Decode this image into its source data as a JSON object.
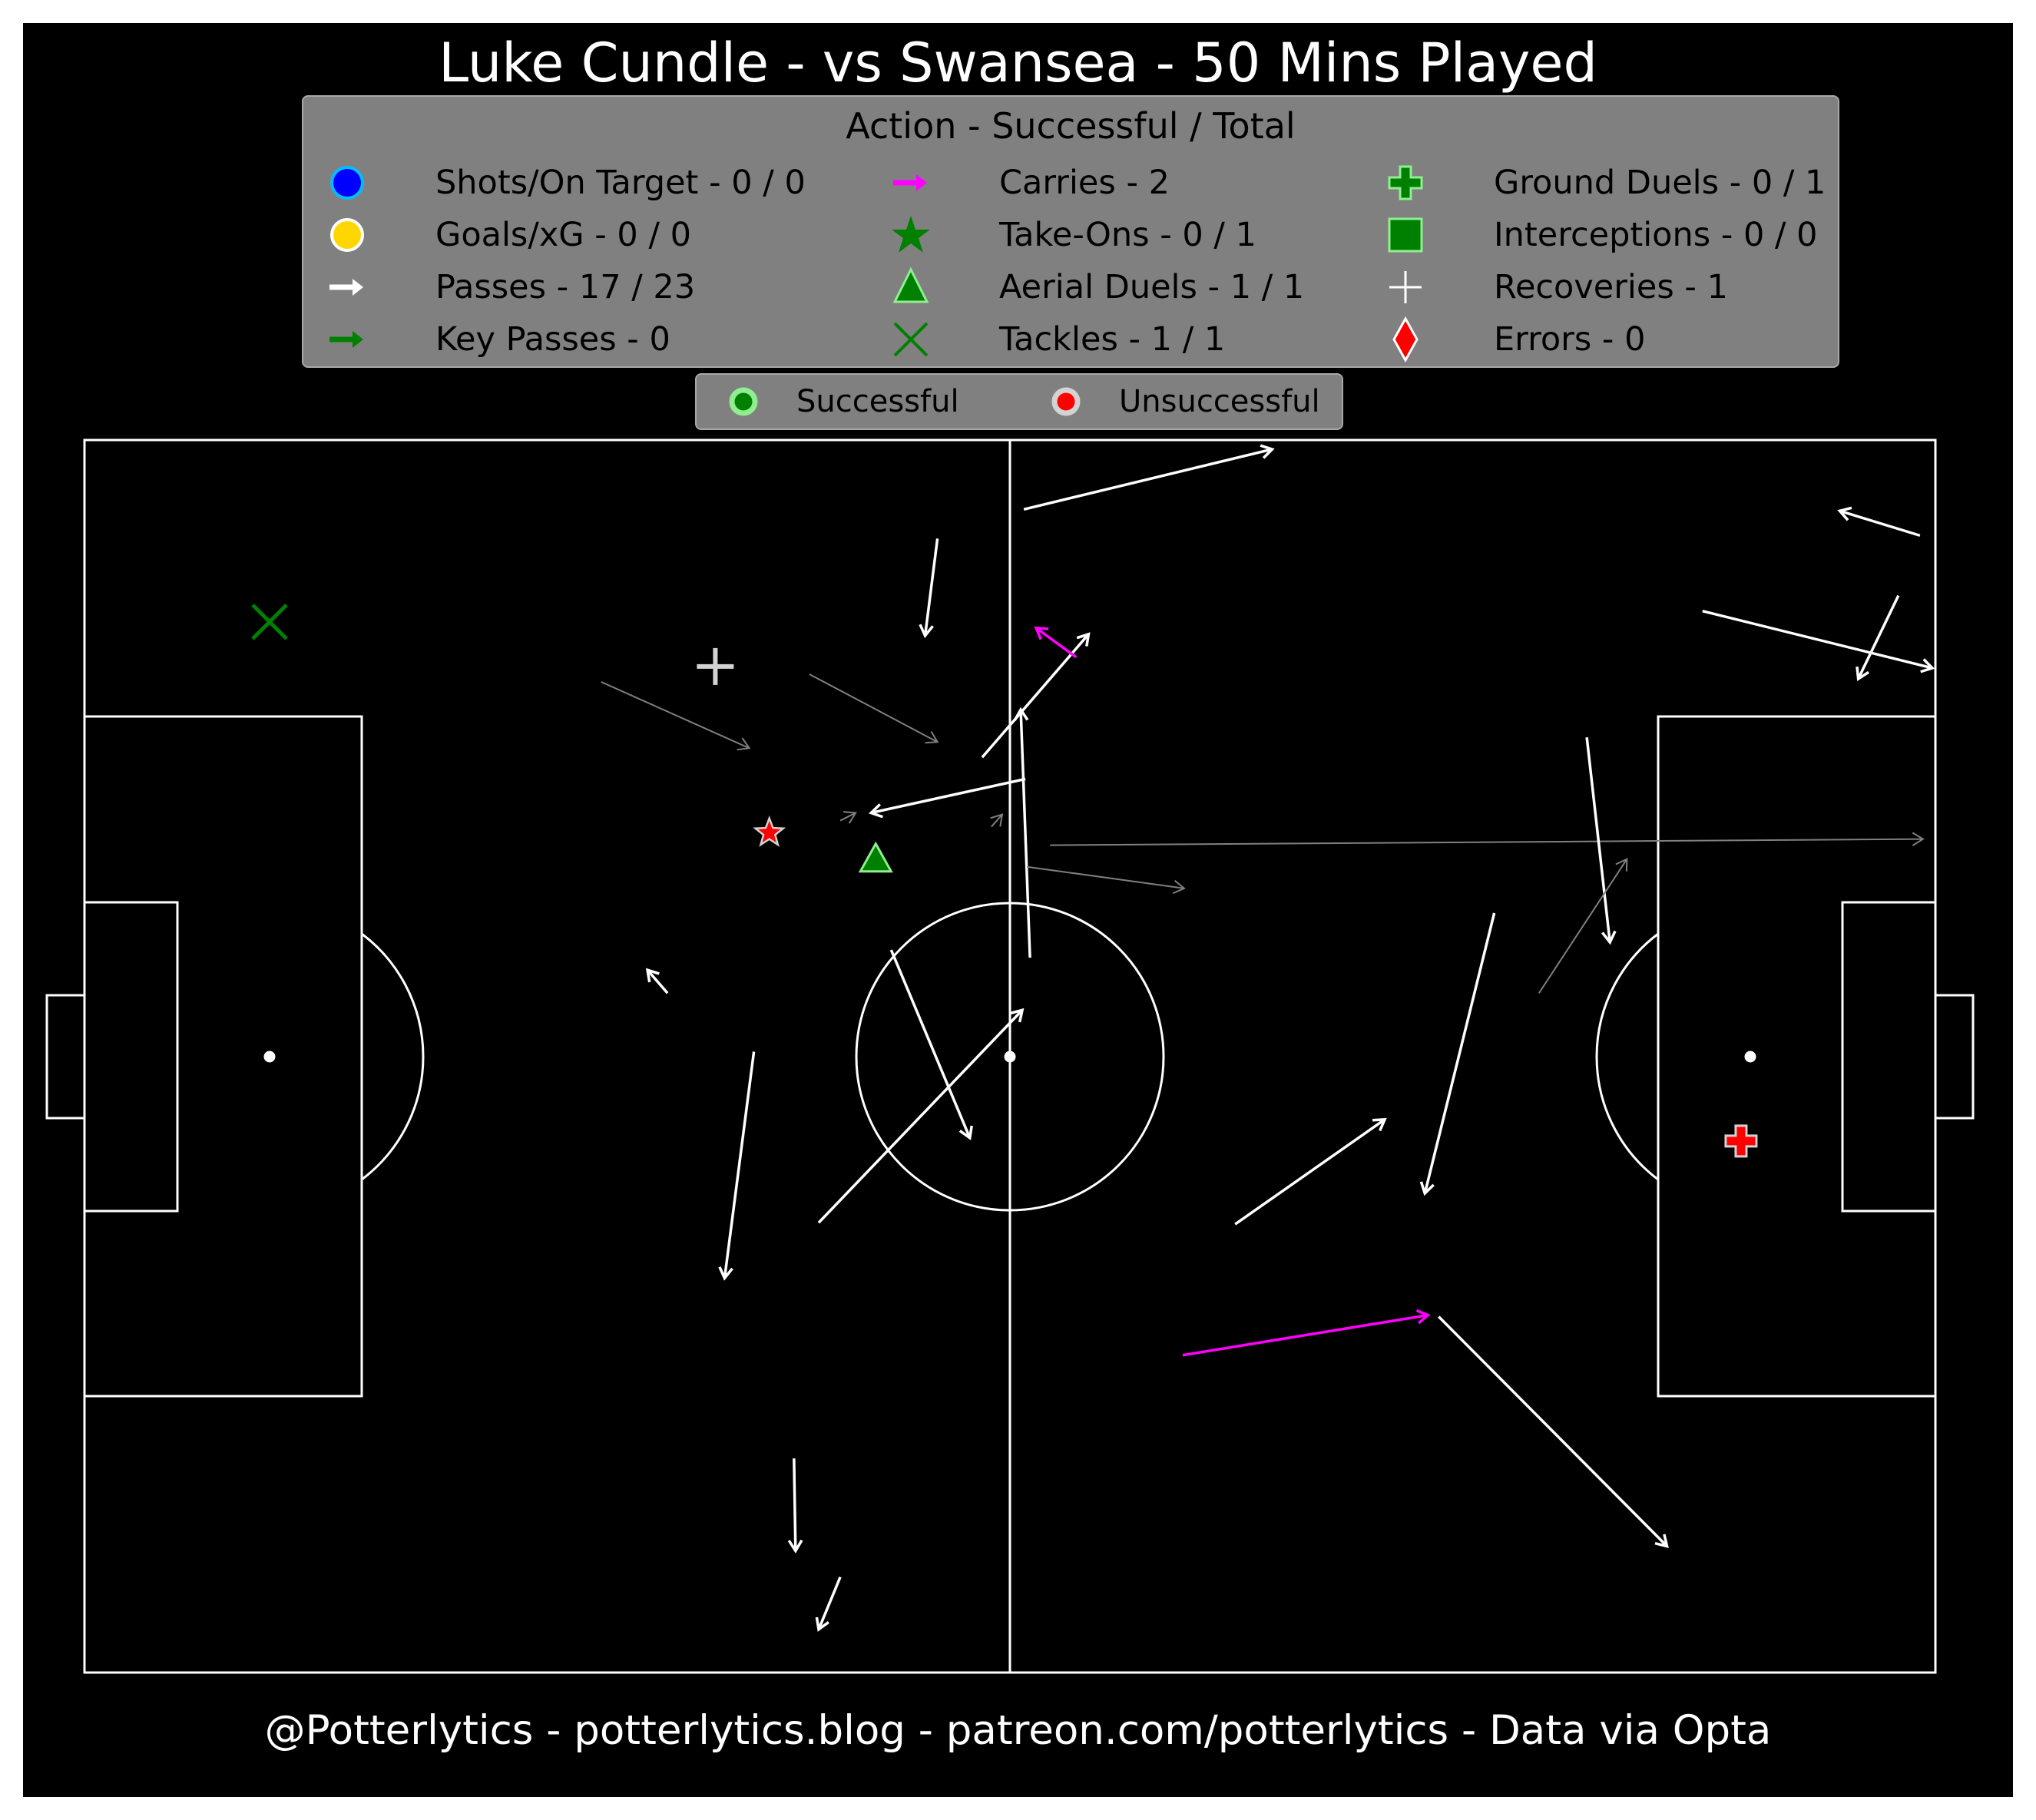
{
  "title": "Luke Cundle - vs Swansea - 50 Mins Played",
  "footer": "@Potterlytics - potterlytics.blog - patreon.com/potterlytics - Data via Opta",
  "legend": {
    "title": "Action - Successful / Total",
    "items": [
      {
        "key": "shots",
        "label": "Shots/On Target - 0 / 0",
        "icon": "circle-icon",
        "color": "#0000ff"
      },
      {
        "key": "goals",
        "label": "Goals/xG - 0 / 0",
        "icon": "circle-icon",
        "color": "#ffd700"
      },
      {
        "key": "passes",
        "label": "Passes - 17 / 23",
        "icon": "arrow-icon",
        "color": "#ffffff"
      },
      {
        "key": "key_passes",
        "label": "Key Passes - 0",
        "icon": "arrow-icon",
        "color": "#008000"
      },
      {
        "key": "carries",
        "label": "Carries - 2",
        "icon": "arrow-icon",
        "color": "#ff00ff"
      },
      {
        "key": "take_ons",
        "label": "Take-Ons - 0 / 1",
        "icon": "star-icon",
        "color": "#008000"
      },
      {
        "key": "aerial_duels",
        "label": "Aerial Duels - 1 / 1",
        "icon": "triangle-icon",
        "color": "#008000"
      },
      {
        "key": "tackles",
        "label": "Tackles - 1 / 1",
        "icon": "x-icon",
        "color": "#008000"
      },
      {
        "key": "ground_duels",
        "label": "Ground Duels - 0 / 1",
        "icon": "plus-icon",
        "color": "#008000"
      },
      {
        "key": "interceptions",
        "label": "Interceptions - 0 / 0",
        "icon": "square-icon",
        "color": "#008000"
      },
      {
        "key": "recoveries",
        "label": "Recoveries - 1",
        "icon": "thin-plus-icon",
        "color": "#ffffff"
      },
      {
        "key": "errors",
        "label": "Errors - 0",
        "icon": "diamond-icon",
        "color": "#ff0000"
      }
    ]
  },
  "outcome_legend": [
    {
      "label": "Successful",
      "icon": "circle-icon",
      "color": "#008000",
      "edge": "#90ee90"
    },
    {
      "label": "Unsuccessful",
      "icon": "circle-icon",
      "color": "#ff0000",
      "edge": "#d3d3d3"
    }
  ],
  "colors": {
    "background": "#000000",
    "lines": "#ffffff",
    "pass_success": "#ffffff",
    "pass_fail": "#808080",
    "carry": "#ff00ff",
    "success": "#008000",
    "fail": "#ff0000"
  },
  "chart_data": {
    "type": "scatter",
    "pitch": {
      "length": 120,
      "width": 80,
      "attack_direction": "left-to-right"
    },
    "passes": [
      {
        "start": [
          55.3,
          73.6
        ],
        "end": [
          54.5,
          67.3
        ],
        "outcome": "successful"
      },
      {
        "start": [
          61.0,
          58.0
        ],
        "end": [
          51.0,
          55.8
        ],
        "outcome": "successful"
      },
      {
        "start": [
          58.2,
          59.4
        ],
        "end": [
          65.1,
          67.4
        ],
        "outcome": "successful"
      },
      {
        "start": [
          47.0,
          64.8
        ],
        "end": [
          55.3,
          60.4
        ],
        "outcome": "unsuccessful"
      },
      {
        "start": [
          52.3,
          46.9
        ],
        "end": [
          57.4,
          34.7
        ],
        "outcome": "successful"
      },
      {
        "start": [
          61.3,
          46.4
        ],
        "end": [
          60.7,
          62.5
        ],
        "outcome": "successful"
      },
      {
        "start": [
          62.6,
          53.7
        ],
        "end": [
          119.2,
          54.1
        ],
        "outcome": "unsuccessful"
      },
      {
        "start": [
          61.1,
          52.3
        ],
        "end": [
          71.3,
          50.9
        ],
        "outcome": "unsuccessful"
      },
      {
        "start": [
          49.0,
          55.3
        ],
        "end": [
          50.0,
          55.8
        ],
        "outcome": "unsuccessful"
      },
      {
        "start": [
          58.8,
          54.9
        ],
        "end": [
          59.5,
          55.7
        ],
        "outcome": "unsuccessful"
      },
      {
        "start": [
          37.8,
          44.1
        ],
        "end": [
          36.5,
          45.6
        ],
        "outcome": "successful"
      },
      {
        "start": [
          43.4,
          40.3
        ],
        "end": [
          41.5,
          25.6
        ],
        "outcome": "successful"
      },
      {
        "start": [
          47.6,
          29.2
        ],
        "end": [
          60.8,
          43.0
        ],
        "outcome": "successful"
      },
      {
        "start": [
          33.5,
          64.3
        ],
        "end": [
          43.1,
          60.0
        ],
        "outcome": "unsuccessful"
      },
      {
        "start": [
          46.0,
          13.9
        ],
        "end": [
          46.1,
          7.9
        ],
        "outcome": "successful"
      },
      {
        "start": [
          49.0,
          6.2
        ],
        "end": [
          47.6,
          2.8
        ],
        "outcome": "successful"
      },
      {
        "start": [
          74.6,
          29.1
        ],
        "end": [
          84.3,
          35.9
        ],
        "outcome": "successful"
      },
      {
        "start": [
          91.4,
          49.3
        ],
        "end": [
          86.9,
          31.1
        ],
        "outcome": "successful"
      },
      {
        "start": [
          97.4,
          60.7
        ],
        "end": [
          98.9,
          47.4
        ],
        "outcome": "successful"
      },
      {
        "start": [
          94.3,
          44.1
        ],
        "end": [
          100.0,
          52.8
        ],
        "outcome": "unsuccessful"
      },
      {
        "start": [
          104.9,
          68.9
        ],
        "end": [
          119.8,
          65.2
        ],
        "outcome": "successful"
      },
      {
        "start": [
          117.6,
          69.9
        ],
        "end": [
          115.0,
          64.5
        ],
        "outcome": "successful"
      },
      {
        "start": [
          87.8,
          23.1
        ],
        "end": [
          102.6,
          8.2
        ],
        "outcome": "successful"
      },
      {
        "start": [
          119.0,
          73.8
        ],
        "end": [
          113.8,
          75.4
        ],
        "outcome": "successful"
      },
      {
        "start": [
          60.9,
          75.5
        ],
        "end": [
          77.0,
          79.4
        ],
        "outcome": "successful"
      }
    ],
    "carries": [
      {
        "start": [
          64.3,
          65.9
        ],
        "end": [
          61.7,
          67.8
        ]
      },
      {
        "start": [
          71.2,
          20.6
        ],
        "end": [
          87.1,
          23.2
        ]
      }
    ],
    "events": [
      {
        "type": "Take-On",
        "x": 44.4,
        "y": 54.5,
        "outcome": "unsuccessful"
      },
      {
        "type": "Aerial Duel",
        "x": 51.3,
        "y": 52.8,
        "outcome": "successful"
      },
      {
        "type": "Tackle",
        "x": 12.0,
        "y": 68.2,
        "outcome": "successful"
      },
      {
        "type": "Recovery",
        "x": 40.9,
        "y": 65.3,
        "outcome": "successful"
      },
      {
        "type": "Ground Duel",
        "x": 107.4,
        "y": 34.5,
        "outcome": "unsuccessful"
      }
    ]
  }
}
